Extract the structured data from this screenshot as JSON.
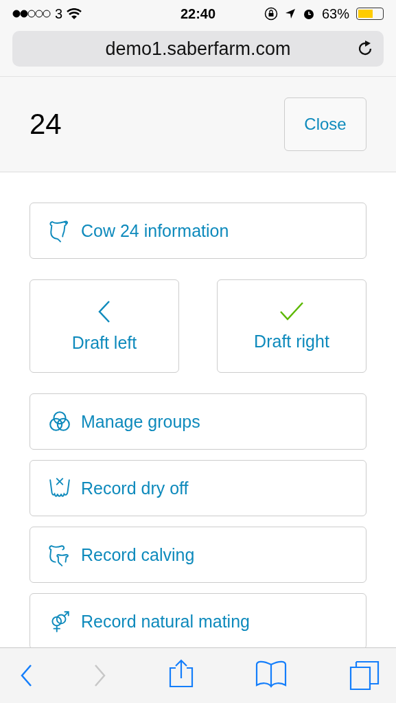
{
  "status_bar": {
    "carrier": "3",
    "time": "22:40",
    "battery": "63%"
  },
  "address_bar": {
    "url": "demo1.saberfarm.com"
  },
  "header": {
    "title": "24",
    "close": "Close"
  },
  "actions": [
    {
      "kind": "wide",
      "label": "Cow 24 information"
    },
    {
      "kind": "pair",
      "left": "Draft left",
      "right": "Draft right"
    },
    {
      "kind": "wide",
      "label": "Manage groups"
    },
    {
      "kind": "wide",
      "label": "Record dry off"
    },
    {
      "kind": "wide",
      "label": "Record calving"
    },
    {
      "kind": "wide",
      "label": "Record natural mating"
    }
  ],
  "toolbar": [
    {
      "disabled": false
    },
    {
      "disabled": true
    },
    {
      "disabled": false
    },
    {
      "disabled": false
    },
    {
      "disabled": false
    }
  ]
}
